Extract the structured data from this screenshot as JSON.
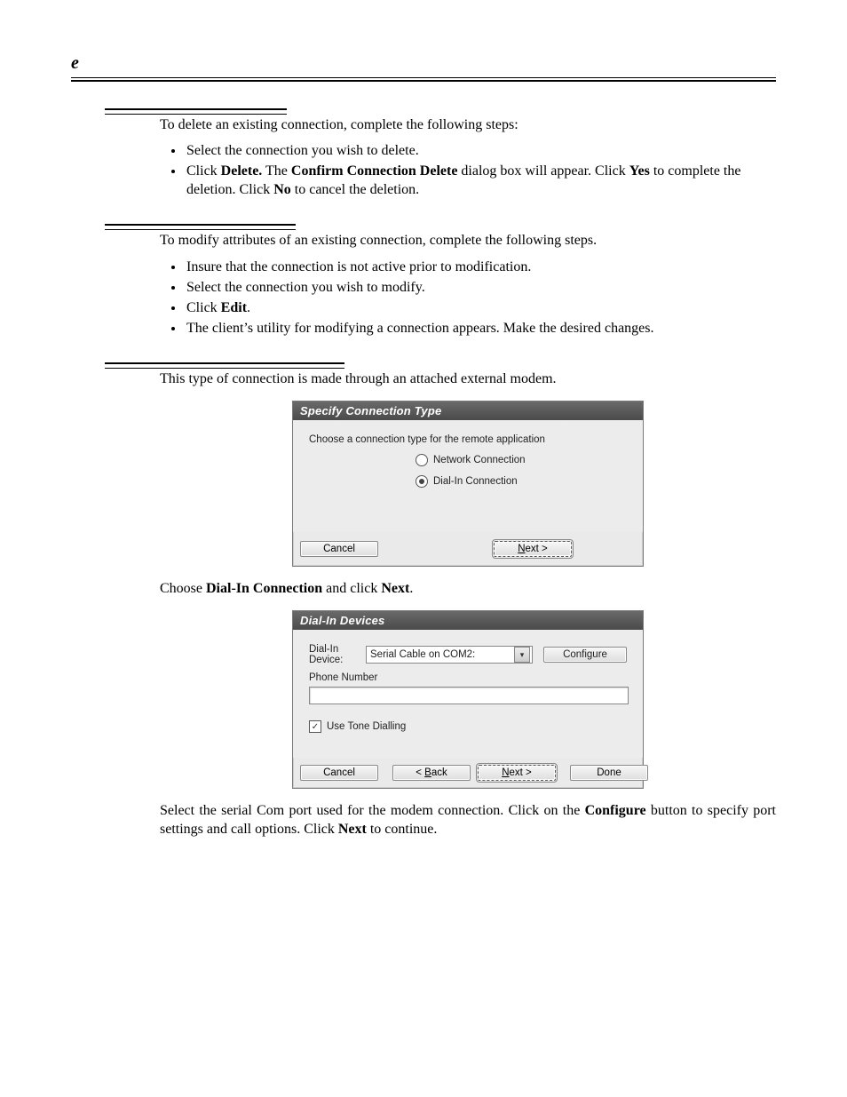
{
  "header": {
    "corner": "e"
  },
  "section1": {
    "intro": "To delete an existing connection, complete the following steps:",
    "bullets": {
      "b0": "Select the connection you wish to delete.",
      "b1_pre": "Click ",
      "b1_strong1": "Delete.",
      "b1_mid": " The ",
      "b1_strong2": "Confirm Connection Delete",
      "b1_post1": " dialog box will appear. Click ",
      "b1_strong3": "Yes",
      "b1_post2": " to complete the deletion. Click ",
      "b1_strong4": "No",
      "b1_post3": " to cancel the deletion."
    }
  },
  "section2": {
    "intro": "To modify attributes of an existing connection, complete the following steps.",
    "bullets": {
      "b0": "Insure that the connection is not active prior to modification.",
      "b1": "Select the connection you wish to modify.",
      "b2_pre": "Click ",
      "b2_strong": "Edit",
      "b2_post": ".",
      "b3": "The client’s utility for modifying a connection appears. Make the desired changes."
    }
  },
  "section3": {
    "intro": "This type of connection is made through an attached external modem.",
    "caption1_pre": "Choose ",
    "caption1_strong1": "Dial-In Connection",
    "caption1_mid": " and click ",
    "caption1_strong2": "Next",
    "caption1_post": ".",
    "caption2_pre": "Select the serial Com port used for the modem connection. Click on the ",
    "caption2_strong1": "Configure",
    "caption2_mid": " button to specify port settings and call options. Click ",
    "caption2_strong2": "Next",
    "caption2_post": " to continue."
  },
  "dlg1": {
    "title": "Specify Connection Type",
    "instruction": "Choose a connection type for the remote application",
    "opt_network": "Network Connection",
    "opt_dialin": "Dial-In Connection",
    "btn_cancel": "Cancel",
    "btn_next_u": "N",
    "btn_next_rest": "ext >"
  },
  "dlg2": {
    "title": "Dial-In Devices",
    "device_label": "Dial-In Device:",
    "device_value": "Serial Cable on COM2:",
    "configure": "Configure",
    "phone_label": "Phone Number",
    "tone_label": "Use Tone Dialling",
    "tone_check": "✓",
    "btn_cancel": "Cancel",
    "btn_back_pre": "< ",
    "btn_back_u": "B",
    "btn_back_rest": "ack",
    "btn_next_u": "N",
    "btn_next_rest": "ext >",
    "btn_done": "Done"
  }
}
